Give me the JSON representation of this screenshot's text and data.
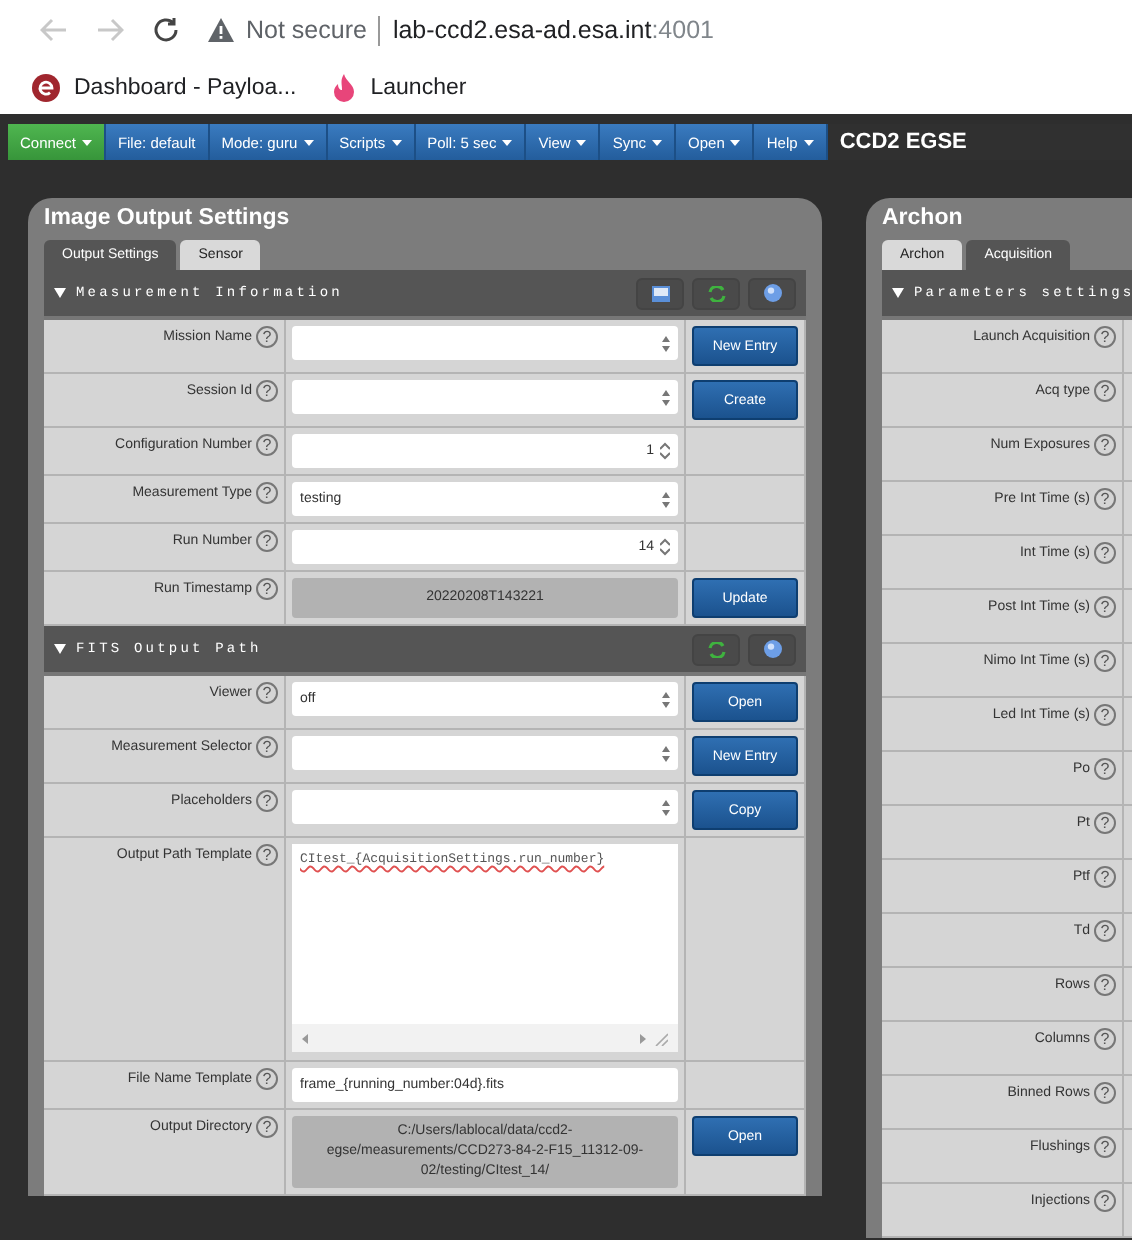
{
  "browser": {
    "security": "Not secure",
    "url_host": "lab-ccd2.esa-ad.esa.int",
    "url_port": ":4001",
    "bookmarks": [
      {
        "label": "Dashboard - Payloa...",
        "kind": "esa"
      },
      {
        "label": "Launcher",
        "kind": "flame"
      }
    ]
  },
  "menu": {
    "items": [
      {
        "label": "Connect",
        "caret": true,
        "kind": "success"
      },
      {
        "label": "File: default",
        "caret": false,
        "kind": "primary"
      },
      {
        "label": "Mode: guru",
        "caret": true,
        "kind": "primary"
      },
      {
        "label": "Scripts",
        "caret": true,
        "kind": "primary"
      },
      {
        "label": "Poll: 5 sec",
        "caret": true,
        "kind": "primary"
      },
      {
        "label": "View",
        "caret": true,
        "kind": "primary"
      },
      {
        "label": "Sync",
        "caret": true,
        "kind": "primary"
      },
      {
        "label": "Open",
        "caret": true,
        "kind": "primary"
      },
      {
        "label": "Help",
        "caret": true,
        "kind": "primary"
      }
    ],
    "title": "CCD2 EGSE"
  },
  "output_panel": {
    "title": "Image Output Settings",
    "tabs": [
      {
        "label": "Output Settings",
        "selected": true
      },
      {
        "label": "Sensor",
        "selected": false
      }
    ],
    "sections": [
      {
        "title": "Measurement Information",
        "expanded": true,
        "tools": [
          {
            "kind": "image"
          },
          {
            "kind": "refresh"
          },
          {
            "kind": "globe"
          }
        ],
        "rows": [
          {
            "label": "Mission Name",
            "help": "?",
            "kind": "select",
            "button": "New Entry"
          },
          {
            "label": "Session Id",
            "help": "?",
            "kind": "select",
            "button": "Create"
          },
          {
            "label": "Configuration Number",
            "help": "?",
            "kind": "spin",
            "value": "1"
          },
          {
            "label": "Measurement Type",
            "help": "?",
            "kind": "select",
            "value": "testing"
          },
          {
            "label": "Run Number",
            "help": "?",
            "kind": "spin",
            "value": "14"
          },
          {
            "label": "Run Timestamp",
            "help": "?",
            "kind": "readonly",
            "value": "20220208T143221",
            "button": "Update"
          }
        ]
      },
      {
        "title": "FITS Output Path",
        "expanded": true,
        "tools": [
          {
            "kind": "refresh"
          },
          {
            "kind": "globe"
          }
        ],
        "rows": [
          {
            "label": "Viewer",
            "help": "?",
            "kind": "select",
            "value": "off",
            "button": "Open"
          },
          {
            "label": "Measurement Selector",
            "help": "?",
            "kind": "select",
            "button": "New Entry"
          },
          {
            "label": "Placeholders",
            "help": "?",
            "kind": "select",
            "button": "Copy"
          },
          {
            "label": "Output Path Template",
            "help": "?",
            "kind": "textarea",
            "value": "CItest_{AcquisitionSettings.run_number}"
          },
          {
            "label": "File Name Template",
            "help": "?",
            "kind": "text",
            "value": "frame_{running_number:04d}.fits"
          },
          {
            "label": "Output Directory",
            "help": "?",
            "kind": "readonly",
            "value": "C:/Users/lablocal/data/ccd2-egse/measurements/CCD273-84-2-F15_11312-09-02/testing/CItest_14/",
            "button": "Open"
          }
        ]
      }
    ]
  },
  "archon_panel": {
    "title": "Archon",
    "tabs": [
      {
        "label": "Archon",
        "selected": false
      },
      {
        "label": "Acquisition",
        "selected": true
      }
    ],
    "sections": [
      {
        "title": "Parameters settings",
        "expanded": true,
        "rows": [
          {
            "label": "Launch Acquisition",
            "help": "?"
          },
          {
            "label": "Acq type",
            "help": "?"
          },
          {
            "label": "Num Exposures",
            "help": "?"
          },
          {
            "label": "Pre Int Time (s)",
            "help": "?"
          },
          {
            "label": "Int Time (s)",
            "help": "?"
          },
          {
            "label": "Post Int Time (s)",
            "help": "?"
          },
          {
            "label": "Nimo Int Time (s)",
            "help": "?"
          },
          {
            "label": "Led Int Time (s)",
            "help": "?"
          },
          {
            "label": "Po",
            "help": "?"
          },
          {
            "label": "Pt",
            "help": "?"
          },
          {
            "label": "Ptf",
            "help": "?"
          },
          {
            "label": "Td",
            "help": "?"
          },
          {
            "label": "Rows",
            "help": "?"
          },
          {
            "label": "Columns",
            "help": "?"
          },
          {
            "label": "Binned Rows",
            "help": "?"
          },
          {
            "label": "Flushings",
            "help": "?"
          },
          {
            "label": "Injections",
            "help": "?"
          }
        ]
      }
    ]
  }
}
